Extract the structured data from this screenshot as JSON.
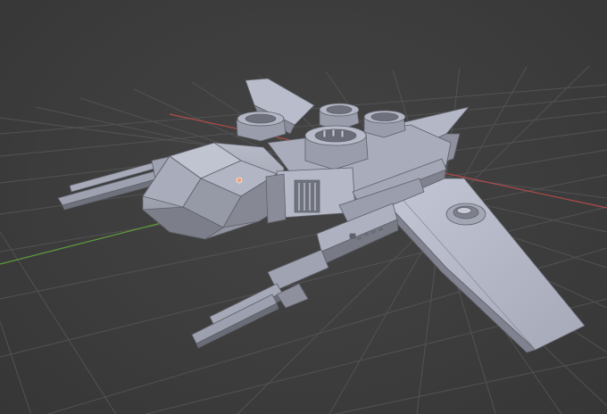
{
  "viewport": {
    "view": "3D Viewport",
    "shading": "solid"
  },
  "scene": {
    "object": "spaceship-model",
    "colors": {
      "background": "#3d3d3d",
      "grid": "#555555",
      "x_axis": "#b34a4a",
      "y_axis": "#5f9c3c",
      "mesh_light": "#b9bccb",
      "mesh_mid": "#9fa2b2",
      "mesh_dark": "#72757f",
      "origin_dot": "#f0a07a"
    }
  }
}
